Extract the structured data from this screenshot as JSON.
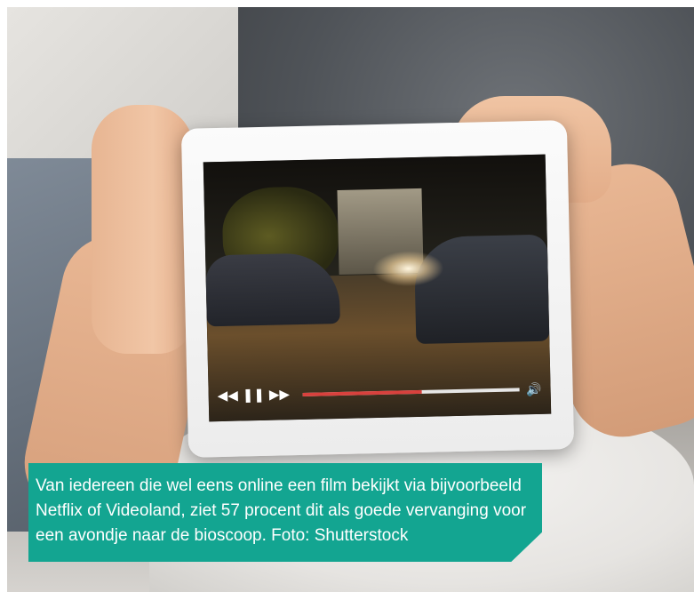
{
  "caption": {
    "lines": [
      "Van iedereen die wel eens online een film bekijkt via bijvoorbeeld",
      "Netflix of Videoland, ziet 57 procent dit als goede vervanging voor",
      "een avondje naar de bioscoop. Foto: Shutterstock"
    ],
    "background_color": "#13a591",
    "text_color": "#ffffff"
  },
  "video_player": {
    "controls": {
      "rewind_icon": "rewind-icon",
      "pause_icon": "pause-icon",
      "forward_icon": "fast-forward-icon",
      "volume_icon": "volume-icon"
    },
    "progress": 0.55,
    "progress_color": "#d8413d",
    "track_color": "#e6e6e6"
  }
}
